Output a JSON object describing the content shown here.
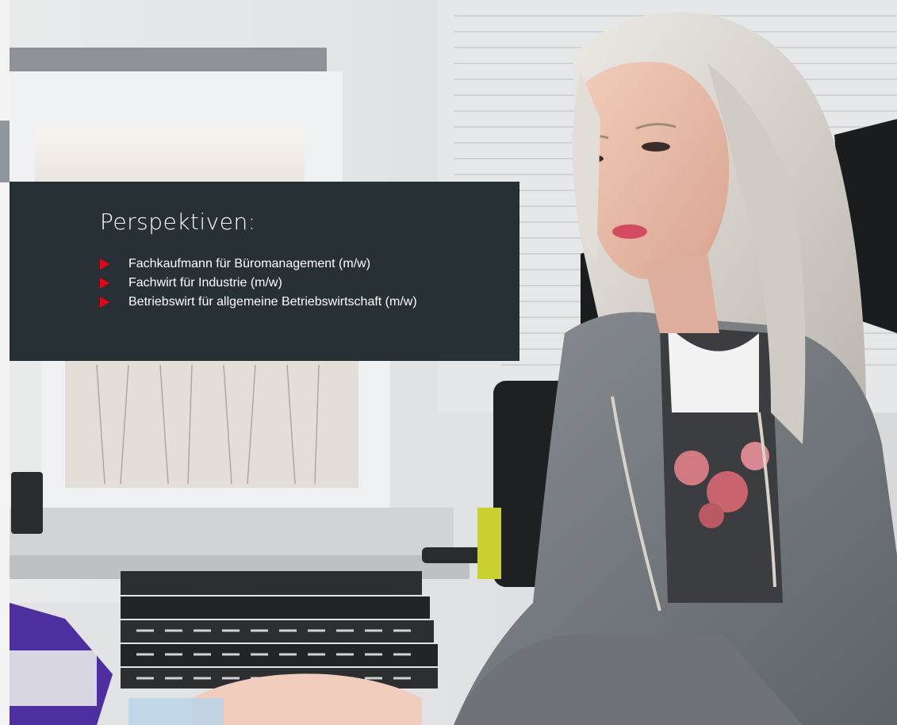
{
  "perspectives": {
    "title": "Perspektiven:",
    "items": [
      {
        "label": "Fachkaufmann für Büromanagement (m/w)",
        "bullet_icon": "red-triangle-bullet-icon"
      },
      {
        "label": "Fachwirt für Industrie (m/w)",
        "bullet_icon": "red-triangle-bullet-icon"
      },
      {
        "label": "Betriebswirt für allgemeine Betriebswirtschaft (m/w)",
        "bullet_icon": "red-triangle-bullet-icon"
      }
    ]
  },
  "colors": {
    "box_background": "#263035",
    "bullet": "#e30613",
    "text": "#ffffff",
    "margin_tab": "#8f979d"
  }
}
